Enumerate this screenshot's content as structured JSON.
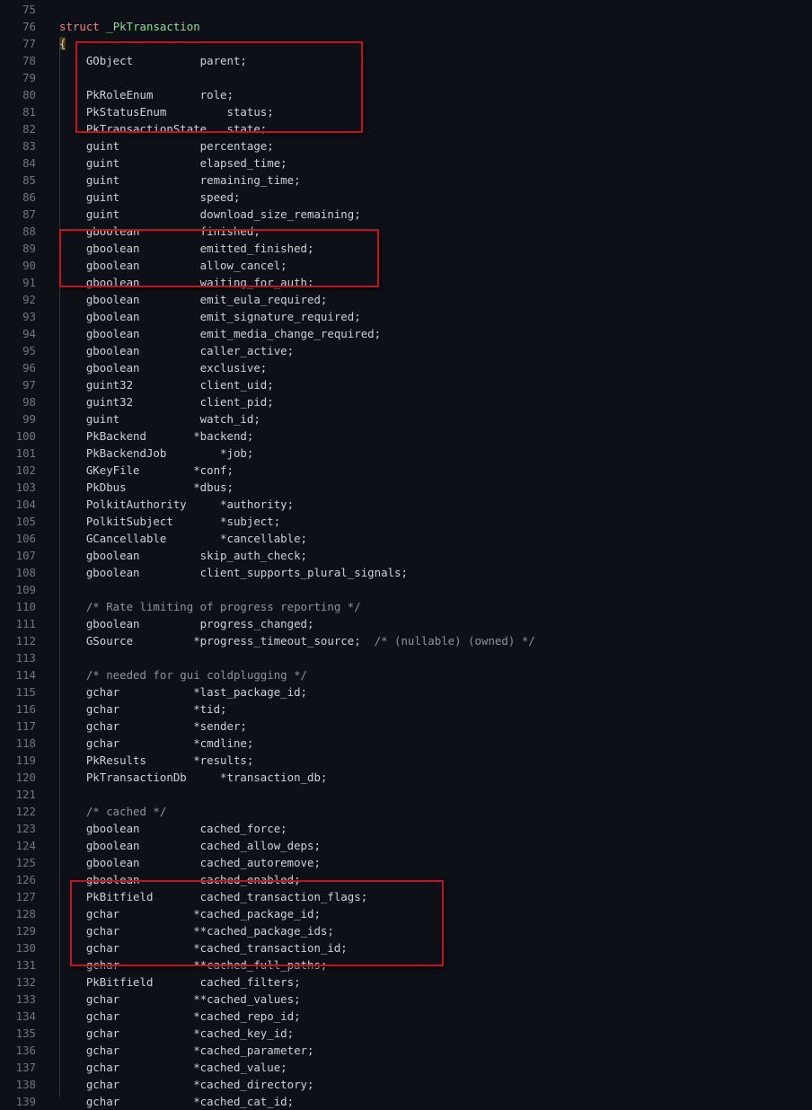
{
  "colors": {
    "background": "#0d1117",
    "text": "#c9d1d9",
    "line_number": "#6e7681",
    "keyword": "#ff7b72",
    "type_name": "#7ee787",
    "comment": "#8b949e",
    "highlight_box": "#c4121e"
  },
  "lines": [
    {
      "n": "75",
      "code": ""
    },
    {
      "n": "76",
      "code": "",
      "struct": {
        "keyword": "struct",
        "name": "_PkTransaction"
      }
    },
    {
      "n": "77",
      "code": "",
      "brace": "{"
    },
    {
      "n": "78",
      "code": "    GObject          parent;"
    },
    {
      "n": "79",
      "code": ""
    },
    {
      "n": "80",
      "code": "    PkRoleEnum       role;"
    },
    {
      "n": "81",
      "code": "    PkStatusEnum         status;"
    },
    {
      "n": "82",
      "code": "    PkTransactionState   state;"
    },
    {
      "n": "83",
      "code": "    guint            percentage;"
    },
    {
      "n": "84",
      "code": "    guint            elapsed_time;"
    },
    {
      "n": "85",
      "code": "    guint            remaining_time;"
    },
    {
      "n": "86",
      "code": "    guint            speed;"
    },
    {
      "n": "87",
      "code": "    guint            download_size_remaining;"
    },
    {
      "n": "88",
      "code": "    gboolean         finished;"
    },
    {
      "n": "89",
      "code": "    gboolean         emitted_finished;"
    },
    {
      "n": "90",
      "code": "    gboolean         allow_cancel;"
    },
    {
      "n": "91",
      "code": "    gboolean         waiting_for_auth;"
    },
    {
      "n": "92",
      "code": "    gboolean         emit_eula_required;"
    },
    {
      "n": "93",
      "code": "    gboolean         emit_signature_required;"
    },
    {
      "n": "94",
      "code": "    gboolean         emit_media_change_required;"
    },
    {
      "n": "95",
      "code": "    gboolean         caller_active;"
    },
    {
      "n": "96",
      "code": "    gboolean         exclusive;"
    },
    {
      "n": "97",
      "code": "    guint32          client_uid;"
    },
    {
      "n": "98",
      "code": "    guint32          client_pid;"
    },
    {
      "n": "99",
      "code": "    guint            watch_id;"
    },
    {
      "n": "100",
      "code": "    PkBackend       *backend;"
    },
    {
      "n": "101",
      "code": "    PkBackendJob        *job;"
    },
    {
      "n": "102",
      "code": "    GKeyFile        *conf;"
    },
    {
      "n": "103",
      "code": "    PkDbus          *dbus;"
    },
    {
      "n": "104",
      "code": "    PolkitAuthority     *authority;"
    },
    {
      "n": "105",
      "code": "    PolkitSubject       *subject;"
    },
    {
      "n": "106",
      "code": "    GCancellable        *cancellable;"
    },
    {
      "n": "107",
      "code": "    gboolean         skip_auth_check;"
    },
    {
      "n": "108",
      "code": "    gboolean         client_supports_plural_signals;"
    },
    {
      "n": "109",
      "code": ""
    },
    {
      "n": "110",
      "code": "",
      "comment": "    /* Rate limiting of progress reporting */"
    },
    {
      "n": "111",
      "code": "    gboolean         progress_changed;"
    },
    {
      "n": "112",
      "code": "    GSource         *progress_timeout_source;  ",
      "comment": "/* (nullable) (owned) */"
    },
    {
      "n": "113",
      "code": ""
    },
    {
      "n": "114",
      "code": "",
      "comment": "    /* needed for gui coldplugging */"
    },
    {
      "n": "115",
      "code": "    gchar           *last_package_id;"
    },
    {
      "n": "116",
      "code": "    gchar           *tid;"
    },
    {
      "n": "117",
      "code": "    gchar           *sender;"
    },
    {
      "n": "118",
      "code": "    gchar           *cmdline;"
    },
    {
      "n": "119",
      "code": "    PkResults       *results;"
    },
    {
      "n": "120",
      "code": "    PkTransactionDb     *transaction_db;"
    },
    {
      "n": "121",
      "code": ""
    },
    {
      "n": "122",
      "code": "",
      "comment": "    /* cached */"
    },
    {
      "n": "123",
      "code": "    gboolean         cached_force;"
    },
    {
      "n": "124",
      "code": "    gboolean         cached_allow_deps;"
    },
    {
      "n": "125",
      "code": "    gboolean         cached_autoremove;"
    },
    {
      "n": "126",
      "code": "    gboolean         cached_enabled;"
    },
    {
      "n": "127",
      "code": "    PkBitfield       cached_transaction_flags;"
    },
    {
      "n": "128",
      "code": "    gchar           *cached_package_id;"
    },
    {
      "n": "129",
      "code": "    gchar           **cached_package_ids;"
    },
    {
      "n": "130",
      "code": "    gchar           *cached_transaction_id;"
    },
    {
      "n": "131",
      "code": "    gchar           **cached_full_paths;"
    },
    {
      "n": "132",
      "code": "    PkBitfield       cached_filters;"
    },
    {
      "n": "133",
      "code": "    gchar           **cached_values;"
    },
    {
      "n": "134",
      "code": "    gchar           *cached_repo_id;"
    },
    {
      "n": "135",
      "code": "    gchar           *cached_key_id;"
    },
    {
      "n": "136",
      "code": "    gchar           *cached_parameter;"
    },
    {
      "n": "137",
      "code": "    gchar           *cached_value;"
    },
    {
      "n": "138",
      "code": "    gchar           *cached_directory;"
    },
    {
      "n": "139",
      "code": "    gchar           *cached_cat_id;"
    }
  ]
}
